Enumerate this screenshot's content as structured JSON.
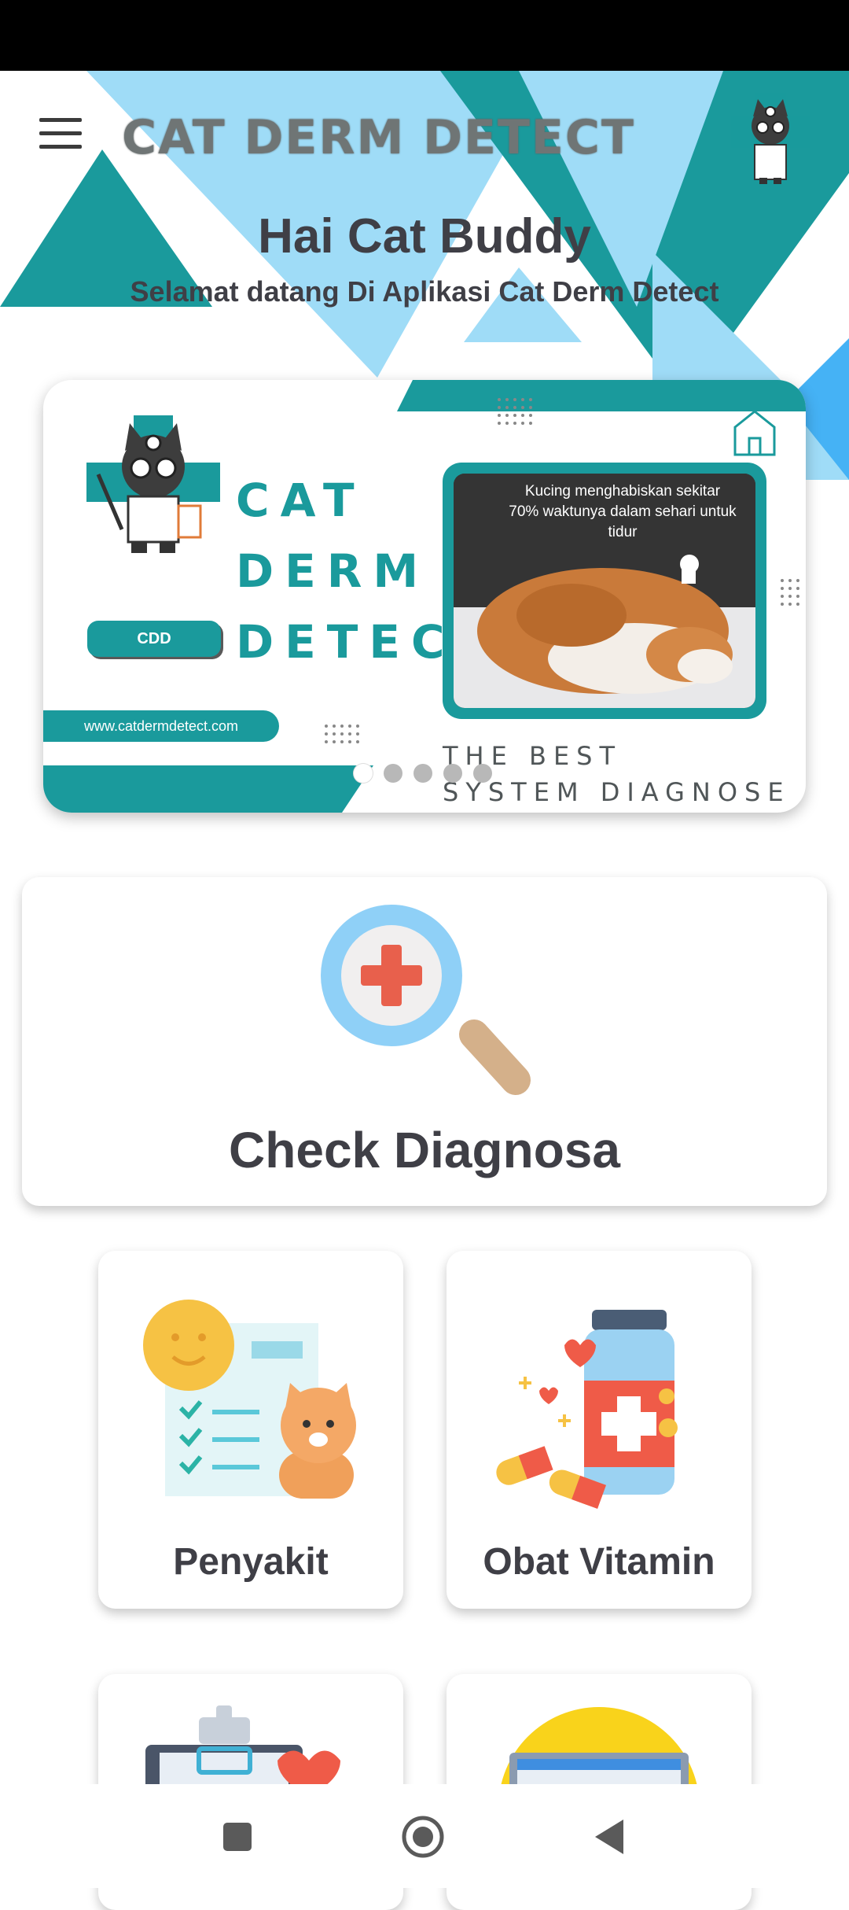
{
  "header": {
    "app_title": "CAT DERM DETECT",
    "greeting": "Hai Cat Buddy",
    "subtitle": "Selamat datang Di Aplikasi Cat Derm Detect"
  },
  "banner": {
    "logo_line1": "CAT",
    "logo_line2": "DERM",
    "logo_line3": "DETECT",
    "badge": "CDD",
    "url": "www.catdermdetect.com",
    "photo_caption": "Kucing menghabiskan sekitar 70% waktunya dalam sehari untuk tidur",
    "tagline_line1": "THE BEST",
    "tagline_line2": "SYSTEM DIAGNOSE",
    "slide_count": 5,
    "active_slide": 1
  },
  "cards": {
    "check_label": "Check Diagnosa",
    "penyakit_label": "Penyakit",
    "obat_label": "Obat Vitamin"
  },
  "icons": [
    "menu-icon",
    "doctor-cat-avatar",
    "magnifier-plus-icon",
    "clipboard-cat-icon",
    "medicine-bottle-icon",
    "home-icon",
    "recent-apps-icon",
    "home-nav-icon",
    "back-nav-icon"
  ],
  "colors": {
    "teal": "#1a9a9c",
    "light_blue": "#9fdcf7",
    "text_dark": "#3f3f46"
  }
}
